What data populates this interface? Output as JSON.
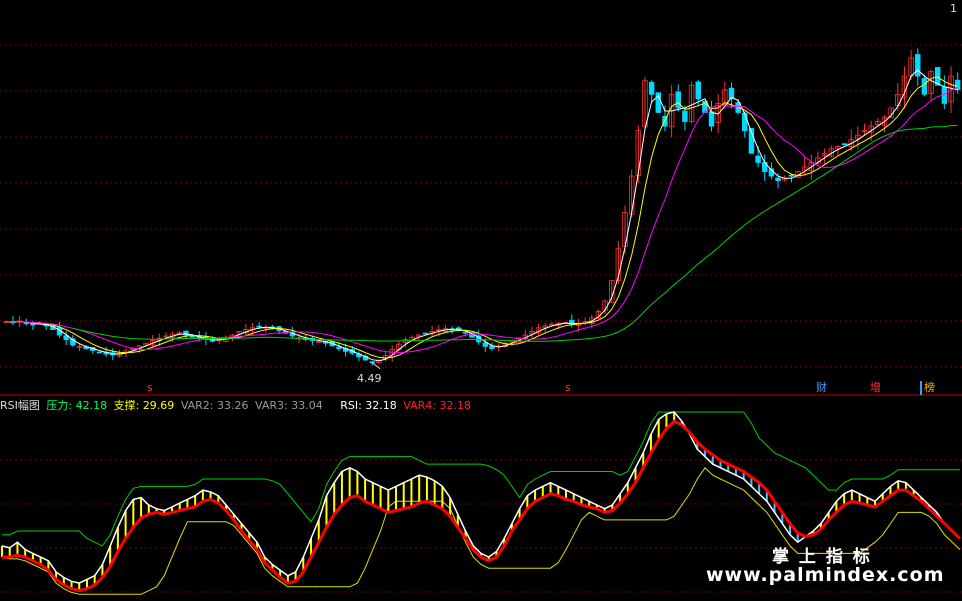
{
  "colors": {
    "background": "#000000",
    "up": "#ff3030",
    "down": "#00d8ff",
    "grid": "#7a0000",
    "ma1": "#ffffff",
    "ma2": "#ffff00",
    "ma3": "#ff00ff",
    "ma4": "#00d000",
    "rsi": "#ffffff",
    "var4": "#ff0000",
    "band": "#00d000",
    "support": "#e0e000",
    "hatch_up": "#ffff00",
    "hatch_down": "#44bbff",
    "divider": "#c00000"
  },
  "indicator_legend": {
    "name": "RSI幅图",
    "pressure_label": "压力:",
    "pressure_value": "42.18",
    "support_label": "支撑:",
    "support_value": "29.69",
    "var2_label": "VAR2:",
    "var2_value": "33.26",
    "var3_label": "VAR3:",
    "var3_value": "33.04",
    "rsi_label": "RSI:",
    "rsi_value": "32.18",
    "var4_label": "VAR4:",
    "var4_value": "32.18"
  },
  "annotations": {
    "low_price": "4.49",
    "high_price": "1",
    "marker_s1": "s",
    "marker_s2": "s",
    "tag_cai": "财",
    "tag_zeng": "增",
    "tag_bang": "榜"
  },
  "watermark": {
    "title": "掌 上 指 标",
    "url": "www.palmindex.com"
  },
  "chart_data": [
    {
      "type": "candlestick",
      "ylim": [
        4.0,
        12.3
      ],
      "grid": true,
      "annotation_low": 4.49,
      "close": [
        5.4,
        5.38,
        5.41,
        5.35,
        5.32,
        5.36,
        5.3,
        5.22,
        5.1,
        5.0,
        4.88,
        4.85,
        4.8,
        4.76,
        4.72,
        4.68,
        4.66,
        4.7,
        4.75,
        4.8,
        4.86,
        4.92,
        4.98,
        5.03,
        5.08,
        5.12,
        5.15,
        5.1,
        5.06,
        5.02,
        5.0,
        4.98,
        5.0,
        5.05,
        5.1,
        5.18,
        5.22,
        5.26,
        5.28,
        5.27,
        5.24,
        5.2,
        5.14,
        5.08,
        5.04,
        5.0,
        4.98,
        4.96,
        4.92,
        4.86,
        4.8,
        4.74,
        4.7,
        4.62,
        4.55,
        4.5,
        4.55,
        4.65,
        4.78,
        4.9,
        5.0,
        5.05,
        5.1,
        5.14,
        5.18,
        5.22,
        5.24,
        5.23,
        5.2,
        5.15,
        5.05,
        4.95,
        4.85,
        4.8,
        4.86,
        4.92,
        4.98,
        5.04,
        5.1,
        5.18,
        5.26,
        5.3,
        5.34,
        5.36,
        5.38,
        5.33,
        5.35,
        5.4,
        5.48,
        5.62,
        5.85,
        6.3,
        7.0,
        7.8,
        8.6,
        9.6,
        10.7,
        10.4,
        10.0,
        9.7,
        10.4,
        10.1,
        9.8,
        10.6,
        10.3,
        10.0,
        9.7,
        10.2,
        10.5,
        10.3,
        10.0,
        9.6,
        9.1,
        8.9,
        8.7,
        8.6,
        8.5,
        8.55,
        8.6,
        8.7,
        8.8,
        8.9,
        9.0,
        9.1,
        9.2,
        9.25,
        9.3,
        9.4,
        9.5,
        9.6,
        9.7,
        9.8,
        9.9,
        10.1,
        10.4,
        10.8,
        11.2,
        10.8,
        10.4,
        10.9,
        10.6,
        10.2,
        10.8,
        10.5
      ]
    },
    {
      "type": "line",
      "ylim": [
        0,
        100
      ],
      "series": [
        {
          "name": "RSI",
          "values": [
            28,
            27,
            30,
            26,
            24,
            22,
            20,
            14,
            11,
            9,
            8,
            10,
            12,
            18,
            28,
            38,
            47,
            53,
            54,
            50,
            48,
            47,
            49,
            51,
            53,
            55,
            58,
            57,
            55,
            50,
            45,
            40,
            35,
            30,
            22,
            18,
            15,
            12,
            14,
            22,
            32,
            42,
            55,
            62,
            68,
            70,
            68,
            64,
            62,
            60,
            58,
            60,
            62,
            64,
            66,
            65,
            63,
            60,
            54,
            45,
            36,
            28,
            24,
            22,
            25,
            32,
            40,
            48,
            55,
            58,
            60,
            62,
            60,
            58,
            56,
            54,
            52,
            50,
            48,
            50,
            56,
            62,
            70,
            78,
            88,
            96,
            99,
            100,
            95,
            88,
            80,
            76,
            72,
            70,
            68,
            66,
            64,
            60,
            56,
            52,
            46,
            40,
            34,
            30,
            33,
            36,
            40,
            46,
            52,
            56,
            58,
            56,
            54,
            52,
            56,
            60,
            63,
            62,
            58,
            54,
            50,
            46,
            40,
            36,
            32
          ]
        },
        {
          "name": "VAR4",
          "values": [
            22,
            22,
            23,
            22,
            20,
            18,
            15,
            10,
            7,
            5,
            4,
            5,
            7,
            11,
            17,
            25,
            32,
            38,
            43,
            45,
            46,
            45,
            46,
            47,
            48,
            49,
            52,
            53,
            51,
            47,
            42,
            36,
            31,
            26,
            19,
            15,
            11,
            8,
            9,
            14,
            22,
            30,
            38,
            45,
            50,
            54,
            55,
            52,
            50,
            48,
            46,
            47,
            48,
            49,
            51,
            52,
            50,
            48,
            44,
            38,
            32,
            26,
            22,
            20,
            22,
            28,
            36,
            42,
            48,
            52,
            54,
            56,
            55,
            53,
            52,
            50,
            49,
            48,
            46,
            47,
            51,
            56,
            62,
            70,
            78,
            85,
            91,
            95,
            93,
            89,
            84,
            80,
            77,
            74,
            72,
            70,
            68,
            65,
            62,
            58,
            52,
            46,
            40,
            35,
            33,
            34,
            37,
            42,
            46,
            50,
            52,
            51,
            50,
            49,
            52,
            55,
            58,
            58,
            55,
            52,
            48,
            44,
            40,
            36,
            32
          ]
        }
      ],
      "pressure": 42.18,
      "support": 29.69,
      "var2": 33.26,
      "var3": 33.04
    }
  ]
}
